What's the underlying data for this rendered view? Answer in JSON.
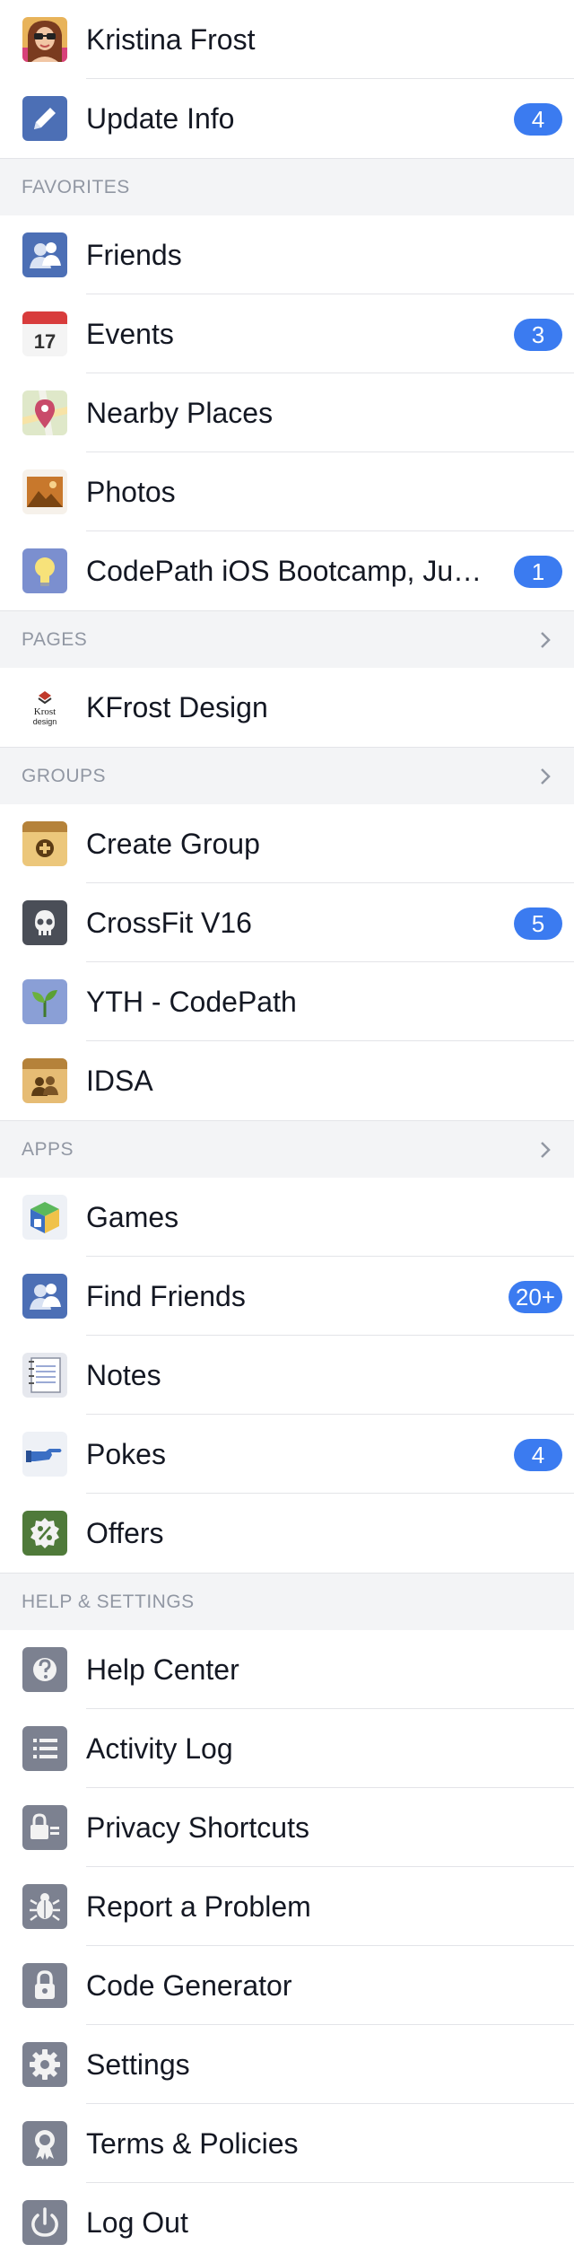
{
  "profile": {
    "name": "Kristina Frost",
    "icon": "user-avatar"
  },
  "update_info": {
    "label": "Update Info",
    "badge": "4",
    "icon": "pencil-icon"
  },
  "favorites": {
    "title": "FAVORITES",
    "items": [
      {
        "label": "Friends",
        "icon": "friends-icon",
        "badge": ""
      },
      {
        "label": "Events",
        "icon": "calendar-icon",
        "icon_text": "17",
        "badge": "3"
      },
      {
        "label": "Nearby Places",
        "icon": "map-pin-icon",
        "badge": ""
      },
      {
        "label": "Photos",
        "icon": "photos-icon",
        "badge": ""
      },
      {
        "label": "CodePath iOS Bootcamp, June...",
        "icon": "lightbulb-icon",
        "badge": "1"
      }
    ]
  },
  "pages": {
    "title": "PAGES",
    "items": [
      {
        "label": "KFrost Design",
        "icon": "kfrost-logo",
        "icon_text_1": "Krost",
        "icon_text_2": "design",
        "badge": ""
      }
    ]
  },
  "groups": {
    "title": "GROUPS",
    "items": [
      {
        "label": "Create Group",
        "icon": "create-group-icon",
        "badge": ""
      },
      {
        "label": "CrossFit V16",
        "icon": "skull-icon",
        "badge": "5"
      },
      {
        "label": "YTH - CodePath",
        "icon": "sprout-icon",
        "badge": ""
      },
      {
        "label": "IDSA",
        "icon": "group-icon",
        "badge": ""
      }
    ]
  },
  "apps": {
    "title": "APPS",
    "items": [
      {
        "label": "Games",
        "icon": "games-icon",
        "badge": ""
      },
      {
        "label": "Find Friends",
        "icon": "find-friends-icon",
        "badge": "20+"
      },
      {
        "label": "Notes",
        "icon": "notes-icon",
        "badge": ""
      },
      {
        "label": "Pokes",
        "icon": "poke-icon",
        "badge": "4"
      },
      {
        "label": "Offers",
        "icon": "offers-icon",
        "badge": ""
      }
    ]
  },
  "help": {
    "title": "HELP & SETTINGS",
    "items": [
      {
        "label": "Help Center",
        "icon": "help-icon",
        "badge": ""
      },
      {
        "label": "Activity Log",
        "icon": "activity-log-icon",
        "badge": ""
      },
      {
        "label": "Privacy Shortcuts",
        "icon": "privacy-lock-icon",
        "badge": ""
      },
      {
        "label": "Report a Problem",
        "icon": "bug-icon",
        "badge": ""
      },
      {
        "label": "Code Generator",
        "icon": "code-lock-icon",
        "badge": ""
      },
      {
        "label": "Settings",
        "icon": "gear-icon",
        "badge": ""
      },
      {
        "label": "Terms & Policies",
        "icon": "ribbon-icon",
        "badge": ""
      },
      {
        "label": "Log Out",
        "icon": "power-icon",
        "badge": ""
      }
    ]
  },
  "colors": {
    "badge": "#3b7bf0",
    "section_bg": "#f3f4f6",
    "section_text": "#9197a3",
    "text": "#141823",
    "separator": "#e3e4e8"
  }
}
